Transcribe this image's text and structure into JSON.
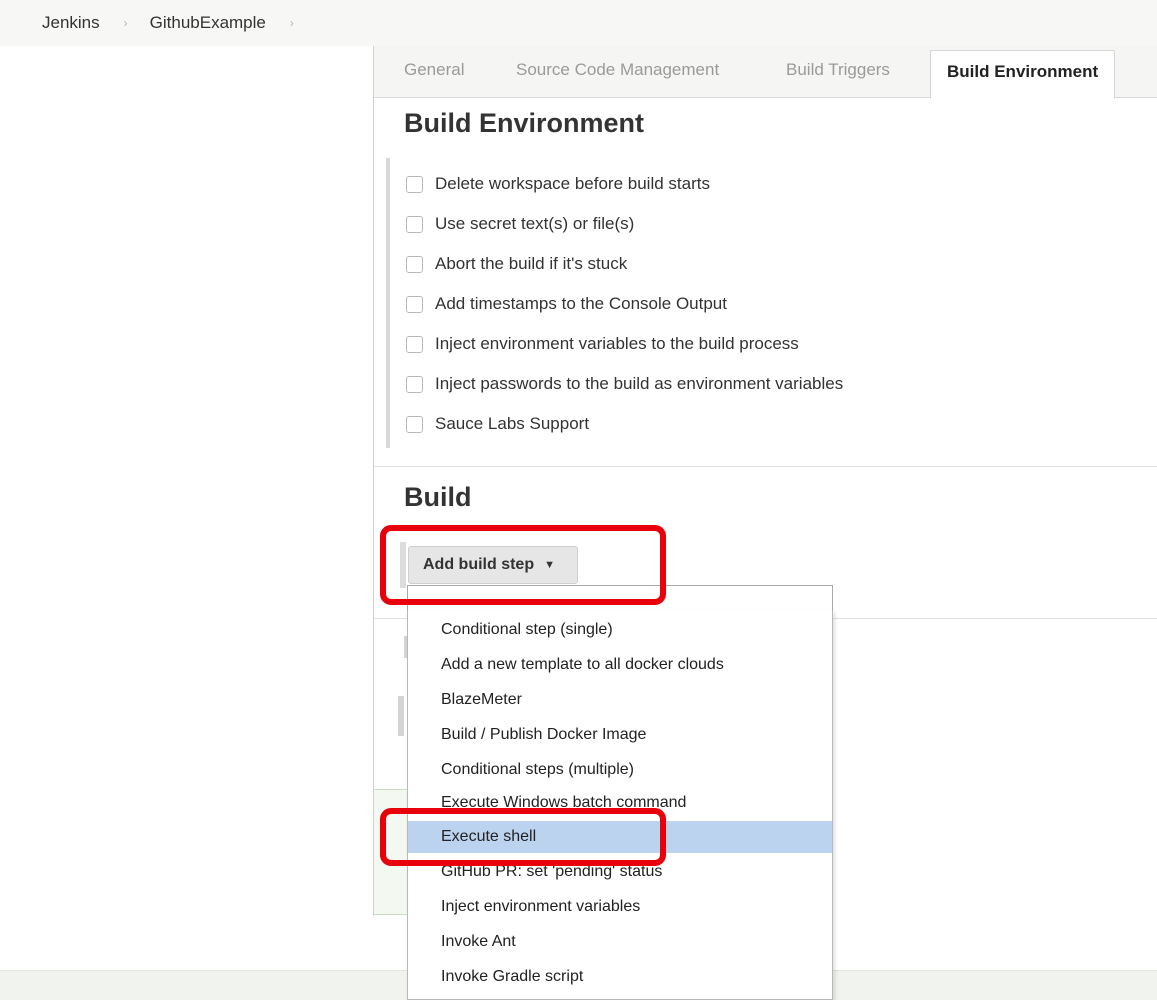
{
  "breadcrumb": {
    "items": [
      "Jenkins",
      "GithubExample"
    ],
    "separator": "›"
  },
  "tabs": [
    {
      "label": "General",
      "active": false
    },
    {
      "label": "Source Code Management",
      "active": false
    },
    {
      "label": "Build Triggers",
      "active": false
    },
    {
      "label": "Build Environment",
      "active": true
    }
  ],
  "build_environment": {
    "title": "Build Environment",
    "options": [
      {
        "label": "Delete workspace before build starts",
        "checked": false
      },
      {
        "label": "Use secret text(s) or file(s)",
        "checked": false
      },
      {
        "label": "Abort the build if it's stuck",
        "checked": false
      },
      {
        "label": "Add timestamps to the Console Output",
        "checked": false
      },
      {
        "label": "Inject environment variables to the build process",
        "checked": false
      },
      {
        "label": "Inject passwords to the build as environment variables",
        "checked": false
      },
      {
        "label": "Sauce Labs Support",
        "checked": false
      }
    ]
  },
  "build": {
    "title": "Build",
    "add_step_label": "Add build step",
    "caret_icon": "▼"
  },
  "dropdown": {
    "filter_value": "",
    "items": [
      {
        "label": "Conditional step (single)"
      },
      {
        "label": "Add a new template to all docker clouds"
      },
      {
        "label": "BlazeMeter"
      },
      {
        "label": "Build / Publish Docker Image"
      },
      {
        "label": "Conditional steps (multiple)"
      },
      {
        "label": "Execute Windows batch command"
      },
      {
        "label": "Execute shell",
        "highlighted": true
      },
      {
        "label": "GitHub PR: set 'pending' status"
      },
      {
        "label": "Inject environment variables"
      },
      {
        "label": "Invoke Ant"
      },
      {
        "label": "Invoke Gradle script"
      }
    ]
  },
  "colors": {
    "annotation": "#e8000b",
    "menu_highlight": "#bcd3f0"
  }
}
